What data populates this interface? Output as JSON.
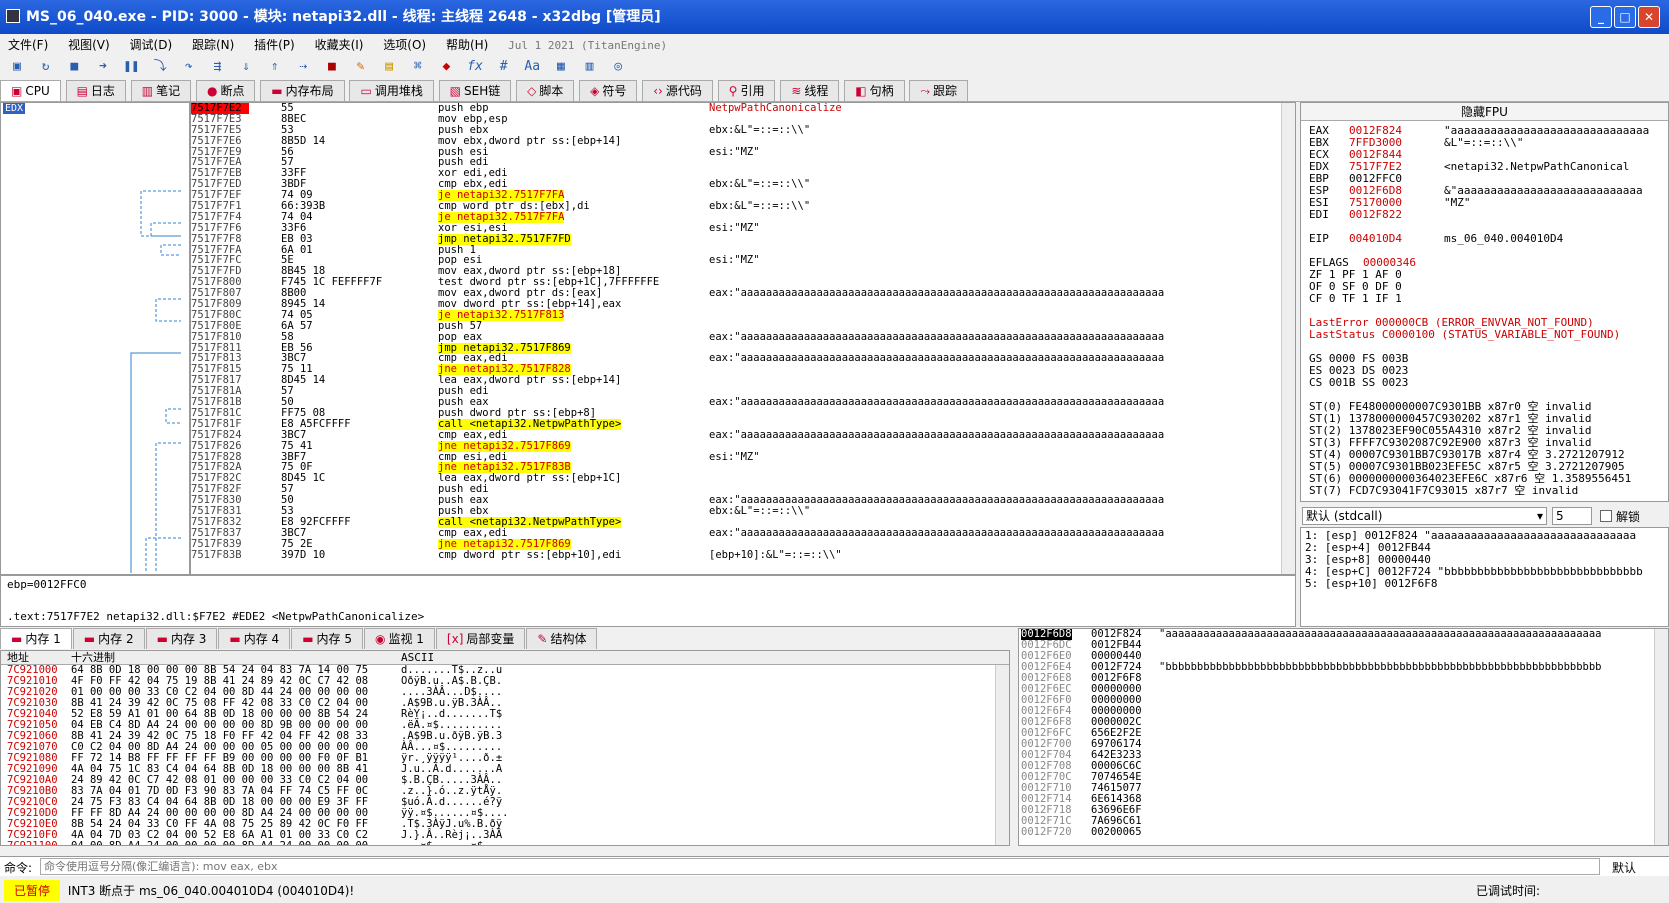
{
  "window": {
    "title": "MS_06_040.exe - PID: 3000 - 模块: netapi32.dll - 线程: 主线程 2648 - x32dbg [管理员]"
  },
  "menu": {
    "items": [
      "文件(F)",
      "视图(V)",
      "调试(D)",
      "跟踪(N)",
      "插件(P)",
      "收藏夹(I)",
      "选项(O)",
      "帮助(H)"
    ],
    "date": "Jul 1 2021 (TitanEngine)"
  },
  "tabs": [
    "CPU",
    "日志",
    "笔记",
    "断点",
    "内存布局",
    "调用堆栈",
    "SEH链",
    "脚本",
    "符号",
    "源代码",
    "引用",
    "线程",
    "句柄",
    "跟踪"
  ],
  "disasm": {
    "edx_label": "EDX",
    "rows": [
      {
        "a": "7517F7E2",
        "b": "55",
        "m": "push ebp",
        "c": "NetpwPathCanonicalize",
        "t": "cur"
      },
      {
        "a": "7517F7E3",
        "b": "8BEC",
        "m": "mov ebp,esp",
        "c": ""
      },
      {
        "a": "7517F7E5",
        "b": "53",
        "m": "push ebx",
        "c": "ebx:&L\"=::=::\\\\\""
      },
      {
        "a": "7517F7E6",
        "b": "8B5D 14",
        "m": "mov ebx,dword ptr ss:[ebp+14]",
        "c": ""
      },
      {
        "a": "7517F7E9",
        "b": "56",
        "m": "push esi",
        "c": "esi:\"MZ\""
      },
      {
        "a": "7517F7EA",
        "b": "57",
        "m": "push edi",
        "c": ""
      },
      {
        "a": "7517F7EB",
        "b": "33FF",
        "m": "xor edi,edi",
        "c": ""
      },
      {
        "a": "7517F7ED",
        "b": "3BDF",
        "m": "cmp ebx,edi",
        "c": "ebx:&L\"=::=::\\\\\""
      },
      {
        "a": "7517F7EF",
        "b": "74 09",
        "m": "je netapi32.7517F7FA",
        "c": "",
        "t": "jcc"
      },
      {
        "a": "7517F7F1",
        "b": "66:393B",
        "m": "cmp word ptr ds:[ebx],di",
        "c": "ebx:&L\"=::=::\\\\\""
      },
      {
        "a": "7517F7F4",
        "b": "74 04",
        "m": "je netapi32.7517F7FA",
        "c": "",
        "t": "jcc"
      },
      {
        "a": "7517F7F6",
        "b": "33F6",
        "m": "xor esi,esi",
        "c": "esi:\"MZ\""
      },
      {
        "a": "7517F7F8",
        "b": "EB 03",
        "m": "jmp netapi32.7517F7FD",
        "c": "",
        "t": "jmp"
      },
      {
        "a": "7517F7FA",
        "b": "6A 01",
        "m": "push 1",
        "c": ""
      },
      {
        "a": "7517F7FC",
        "b": "5E",
        "m": "pop esi",
        "c": "esi:\"MZ\""
      },
      {
        "a": "7517F7FD",
        "b": "8B45 18",
        "m": "mov eax,dword ptr ss:[ebp+18]",
        "c": ""
      },
      {
        "a": "7517F800",
        "b": "F745 1C FEFFFF7F",
        "m": "test dword ptr ss:[ebp+1C],7FFFFFFE",
        "c": ""
      },
      {
        "a": "7517F807",
        "b": "8B00",
        "m": "mov eax,dword ptr ds:[eax]",
        "c": "eax:\"aaaaaaaaaaaaaaaaaaaaaaaaaaaaaaaaaaaaaaaaaaaaaaaaaaaaaaaaaaaaaaaaaaa"
      },
      {
        "a": "7517F809",
        "b": "8945 14",
        "m": "mov dword ptr ss:[ebp+14],eax",
        "c": ""
      },
      {
        "a": "7517F80C",
        "b": "74 05",
        "m": "je netapi32.7517F813",
        "c": "",
        "t": "jcc"
      },
      {
        "a": "7517F80E",
        "b": "6A 57",
        "m": "push 57",
        "c": ""
      },
      {
        "a": "7517F810",
        "b": "58",
        "m": "pop eax",
        "c": "eax:\"aaaaaaaaaaaaaaaaaaaaaaaaaaaaaaaaaaaaaaaaaaaaaaaaaaaaaaaaaaaaaaaaaaa"
      },
      {
        "a": "7517F811",
        "b": "EB 56",
        "m": "jmp netapi32.7517F869",
        "c": "",
        "t": "jmp"
      },
      {
        "a": "7517F813",
        "b": "3BC7",
        "m": "cmp eax,edi",
        "c": "eax:\"aaaaaaaaaaaaaaaaaaaaaaaaaaaaaaaaaaaaaaaaaaaaaaaaaaaaaaaaaaaaaaaaaaa"
      },
      {
        "a": "7517F815",
        "b": "75 11",
        "m": "jne netapi32.7517F828",
        "c": "",
        "t": "jcc"
      },
      {
        "a": "7517F817",
        "b": "8D45 14",
        "m": "lea eax,dword ptr ss:[ebp+14]",
        "c": ""
      },
      {
        "a": "7517F81A",
        "b": "57",
        "m": "push edi",
        "c": ""
      },
      {
        "a": "7517F81B",
        "b": "50",
        "m": "push eax",
        "c": "eax:\"aaaaaaaaaaaaaaaaaaaaaaaaaaaaaaaaaaaaaaaaaaaaaaaaaaaaaaaaaaaaaaaaaaa"
      },
      {
        "a": "7517F81C",
        "b": "FF75 08",
        "m": "push dword ptr ss:[ebp+8]",
        "c": ""
      },
      {
        "a": "7517F81F",
        "b": "E8 A5FCFFFF",
        "m": "call <netapi32.NetpwPathType>",
        "c": "",
        "t": "call"
      },
      {
        "a": "7517F824",
        "b": "3BC7",
        "m": "cmp eax,edi",
        "c": "eax:\"aaaaaaaaaaaaaaaaaaaaaaaaaaaaaaaaaaaaaaaaaaaaaaaaaaaaaaaaaaaaaaaaaaa"
      },
      {
        "a": "7517F826",
        "b": "75 41",
        "m": "jne netapi32.7517F869",
        "c": "",
        "t": "jcc"
      },
      {
        "a": "7517F828",
        "b": "3BF7",
        "m": "cmp esi,edi",
        "c": "esi:\"MZ\""
      },
      {
        "a": "7517F82A",
        "b": "75 0F",
        "m": "jne netapi32.7517F83B",
        "c": "",
        "t": "jcc"
      },
      {
        "a": "7517F82C",
        "b": "8D45 1C",
        "m": "lea eax,dword ptr ss:[ebp+1C]",
        "c": ""
      },
      {
        "a": "7517F82F",
        "b": "57",
        "m": "push edi",
        "c": ""
      },
      {
        "a": "7517F830",
        "b": "50",
        "m": "push eax",
        "c": "eax:\"aaaaaaaaaaaaaaaaaaaaaaaaaaaaaaaaaaaaaaaaaaaaaaaaaaaaaaaaaaaaaaaaaaa"
      },
      {
        "a": "7517F831",
        "b": "53",
        "m": "push ebx",
        "c": "ebx:&L\"=::=::\\\\\""
      },
      {
        "a": "7517F832",
        "b": "E8 92FCFFFF",
        "m": "call <netapi32.NetpwPathType>",
        "c": "",
        "t": "call"
      },
      {
        "a": "7517F837",
        "b": "3BC7",
        "m": "cmp eax,edi",
        "c": "eax:\"aaaaaaaaaaaaaaaaaaaaaaaaaaaaaaaaaaaaaaaaaaaaaaaaaaaaaaaaaaaaaaaaaaa"
      },
      {
        "a": "7517F839",
        "b": "75 2E",
        "m": "jne netapi32.7517F869",
        "c": "",
        "t": "jcc"
      },
      {
        "a": "7517F83B",
        "b": "397D 10",
        "m": "cmp dword ptr ss:[ebp+10],edi",
        "c": "[ebp+10]:&L\"=::=::\\\\\""
      }
    ]
  },
  "registers": {
    "header": "隐藏FPU",
    "gp": [
      {
        "n": "EAX",
        "v": "0012F824",
        "c": "\"aaaaaaaaaaaaaaaaaaaaaaaaaaaaaa"
      },
      {
        "n": "EBX",
        "v": "7FFD3000",
        "c": "&L\"=::=::\\\\\""
      },
      {
        "n": "ECX",
        "v": "0012F844",
        "c": ""
      },
      {
        "n": "EDX",
        "v": "7517F7E2",
        "c": "<netapi32.NetpwPathCanonical"
      },
      {
        "n": "EBP",
        "v": "0012FFC0",
        "c": ""
      },
      {
        "n": "ESP",
        "v": "0012F6D8",
        "c": "&\"aaaaaaaaaaaaaaaaaaaaaaaaaaaa"
      },
      {
        "n": "ESI",
        "v": "75170000",
        "c": "\"MZ\""
      },
      {
        "n": "EDI",
        "v": "0012F822",
        "c": ""
      }
    ],
    "eip": {
      "n": "EIP",
      "v": "004010D4",
      "c": "ms_06_040.004010D4"
    },
    "eflags": {
      "n": "EFLAGS",
      "v": "00000346"
    },
    "flags": [
      "ZF 1  PF 1  AF 0",
      "OF 0  SF 0  DF 0",
      "CF 0  TF 1  IF 1"
    ],
    "lasterror": "LastError  000000CB (ERROR_ENVVAR_NOT_FOUND)",
    "laststatus": "LastStatus C0000100 (STATUS_VARIABLE_NOT_FOUND)",
    "seg": [
      "GS 0000  FS 003B",
      "ES 0023  DS 0023",
      "CS 001B  SS 0023"
    ],
    "fpu": [
      "ST(0) FE48000000007C9301BB x87r0 空 invalid",
      "ST(1) 1378000000457C930202 x87r1 空 invalid",
      "ST(2) 1378023EF90C055A4310 x87r2 空 invalid",
      "ST(3) FFFF7C9302087C92E900 x87r3 空 invalid",
      "ST(4) 00007C9301BB7C93017B x87r4 空 3.2721207912",
      "ST(5) 00007C9301BB023EFE5C x87r5 空 3.2721207905",
      "ST(6) 0000000000364023EFE6C x87r6 空 1.3589556451",
      "ST(7) FCD7C93041F7C93015 x87r7 空 invalid"
    ]
  },
  "callconv": {
    "label": "默认 (stdcall)",
    "count": "5",
    "unlock": "解锁"
  },
  "stackargs": [
    "1: [esp] 0012F824 \"aaaaaaaaaaaaaaaaaaaaaaaaaaaaaaa",
    "2: [esp+4] 0012FB44",
    "3: [esp+8] 00000440",
    "4: [esp+C] 0012F724 \"bbbbbbbbbbbbbbbbbbbbbbbbbbbbbb",
    "5: [esp+10] 0012F6F8"
  ],
  "info": {
    "line1": "ebp=0012FFC0",
    "line2": ".text:7517F7E2 netapi32.dll:$F7E2 #EDE2 <NetpwPathCanonicalize>"
  },
  "dumptabs": [
    "内存 1",
    "内存 2",
    "内存 3",
    "内存 4",
    "内存 5",
    "监视 1",
    "局部变量",
    "结构体"
  ],
  "dump": {
    "hdr_addr": "地址",
    "hdr_hex": "十六进制",
    "hdr_ascii": "ASCII",
    "rows": [
      {
        "a": "7C921000",
        "h": "64 8B 0D 18 00 00 00 8B 54 24 04 83 7A 14 00 75",
        "s": "d.......T$..z..u"
      },
      {
        "a": "7C921010",
        "h": "4F F0 FF 42 04 75 19 8B 41 24 89 42 0C C7 42 08",
        "s": "OðÿB.u..A$.B.ÇB."
      },
      {
        "a": "7C921020",
        "h": "01 00 00 00 33 C0 C2 04 00 8D 44 24 00 00 00 00",
        "s": "....3ÀÂ...D$...."
      },
      {
        "a": "7C921030",
        "h": "8B 41 24 39 42 0C 75 08 FF 42 08 33 C0 C2 04 00",
        "s": ".A$9B.u.ÿB.3ÀÂ.."
      },
      {
        "a": "7C921040",
        "h": "52 E8 59 A1 01 00 64 8B 0D 18 00 00 00 8B 54 24",
        "s": "RèY¡..d.......T$"
      },
      {
        "a": "7C921050",
        "h": "04 EB C4 8D A4 24 00 00 00 00 8D 9B 00 00 00 00",
        "s": ".ëÄ.¤$.........."
      },
      {
        "a": "7C921060",
        "h": "8B 41 24 39 42 0C 75 18 F0 FF 42 04 FF 42 08 33",
        "s": ".A$9B.u.ðÿB.ÿB.3"
      },
      {
        "a": "7C921070",
        "h": "C0 C2 04 00 8D A4 24 00 00 00 05 00 00 00 00 00",
        "s": "ÀÂ...¤$........."
      },
      {
        "a": "7C921080",
        "h": "FF 72 14 B8 FF FF FF FF B9 00 00 00 00 F0 0F B1",
        "s": "ÿr.¸ÿÿÿÿ¹....ð.±"
      },
      {
        "a": "7C921090",
        "h": "4A 04 75 1C 83 C4 04 64 8B 0D 18 00 00 00 8B 41",
        "s": "J.u..Ä.d.......A"
      },
      {
        "a": "7C9210A0",
        "h": "24 89 42 0C C7 42 08 01 00 00 00 33 C0 C2 04 00",
        "s": "$.B.ÇB.....3ÀÂ.."
      },
      {
        "a": "7C9210B0",
        "h": "83 7A 04 01 7D 0D F3 90 83 7A 04 FF 74 C5 FF 0C",
        "s": ".z..}.ó..z.ÿtÅÿ."
      },
      {
        "a": "7C9210C0",
        "h": "24 75 F3 83 C4 04 64 8B 0D 18 00 00 00 E9 3F FF",
        "s": "$uó.Ä.d......é?ÿ"
      },
      {
        "a": "7C9210D0",
        "h": "FF FF 8D A4 24 00 00 00 00 8D A4 24 00 00 00 00",
        "s": "ÿÿ.¤$......¤$...."
      },
      {
        "a": "7C9210E0",
        "h": "8B 54 24 04 33 C0 FF 4A 08 75 25 89 42 0C F0 FF",
        "s": ".T$.3ÀÿJ.u%.B.ðÿ"
      },
      {
        "a": "7C9210F0",
        "h": "4A 04 7D 03 C2 04 00 52 E8 6A A1 01 00 33 C0 C2",
        "s": "J.}.Â..Rèj¡..3ÀÂ"
      },
      {
        "a": "7C921100",
        "h": "04 00 8D A4 24 00 00 00 00 8D A4 24 00 00 00 00",
        "s": "...¤$......¤$...."
      }
    ]
  },
  "stack": {
    "rows": [
      {
        "a": "0012F6D8",
        "v": "0012F824",
        "c": "\"aaaaaaaaaaaaaaaaaaaaaaaaaaaaaaaaaaaaaaaaaaaaaaaaaaaaaaaaaaaaaaaaaaaaa",
        "t": "cur"
      },
      {
        "a": "0012F6DC",
        "v": "0012FB44",
        "c": ""
      },
      {
        "a": "0012F6E0",
        "v": "00000440",
        "c": ""
      },
      {
        "a": "0012F6E4",
        "v": "0012F724",
        "c": "\"bbbbbbbbbbbbbbbbbbbbbbbbbbbbbbbbbbbbbbbbbbbbbbbbbbbbbbbbbbbbbbbbbbbbb"
      },
      {
        "a": "0012F6E8",
        "v": "0012F6F8",
        "c": ""
      },
      {
        "a": "0012F6EC",
        "v": "00000000",
        "c": ""
      },
      {
        "a": "0012F6F0",
        "v": "00000000",
        "c": ""
      },
      {
        "a": "0012F6F4",
        "v": "00000000",
        "c": ""
      },
      {
        "a": "0012F6F8",
        "v": "0000002C",
        "c": ""
      },
      {
        "a": "0012F6FC",
        "v": "656E2F2E",
        "c": ""
      },
      {
        "a": "0012F700",
        "v": "69706174",
        "c": ""
      },
      {
        "a": "0012F704",
        "v": "642E3233",
        "c": ""
      },
      {
        "a": "0012F708",
        "v": "00006C6C",
        "c": ""
      },
      {
        "a": "0012F70C",
        "v": "7074654E",
        "c": ""
      },
      {
        "a": "0012F710",
        "v": "74615077",
        "c": ""
      },
      {
        "a": "0012F714",
        "v": "6E614368",
        "c": ""
      },
      {
        "a": "0012F718",
        "v": "63696E6F",
        "c": ""
      },
      {
        "a": "0012F71C",
        "v": "7A696C61",
        "c": ""
      },
      {
        "a": "0012F720",
        "v": "00200065",
        "c": ""
      }
    ]
  },
  "cmd": {
    "label": "命令:",
    "placeholder": "命令使用逗号分隔(像汇编语言): mov eax, ebx",
    "right": "默认"
  },
  "status": {
    "paused": "已暂停",
    "msg": "INT3 断点于 ms_06_040.004010D4 (004010D4)!",
    "time": "已调试时间:"
  }
}
